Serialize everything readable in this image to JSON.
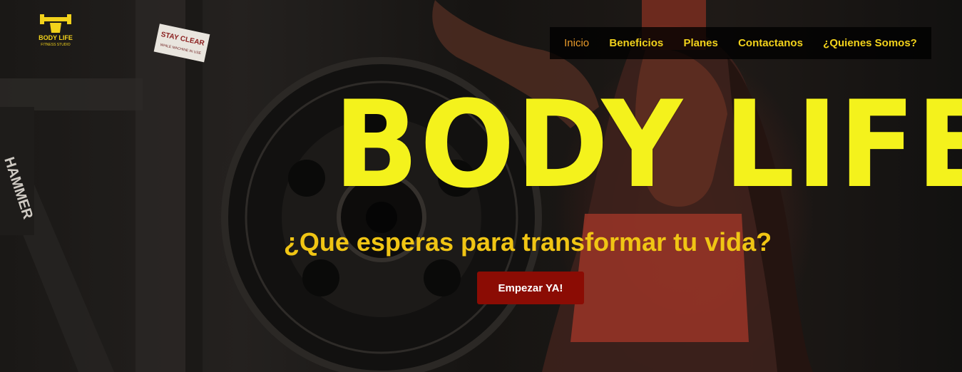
{
  "logo": {
    "icon": "dumbbell-fist-icon",
    "name": "BODY LIFE",
    "subtitle": "FITNESS STUDIO"
  },
  "nav": {
    "items": [
      {
        "label": "Inicio",
        "active": true
      },
      {
        "label": "Beneficios",
        "active": false
      },
      {
        "label": "Planes",
        "active": false
      },
      {
        "label": "Contactanos",
        "active": false
      },
      {
        "label": "¿Quienes Somos?",
        "active": false
      }
    ]
  },
  "hero": {
    "brand": "BODY LIFE",
    "tagline": "¿Que esperas para transformar tu vida?",
    "cta_label": "Empezar YA!",
    "equipment_sign": "STAY CLEAR",
    "equipment_sign_sub": "WHILE MACHINE IN USE",
    "machine_label": "HAMMER"
  },
  "colors": {
    "accent_yellow": "#f2d21b",
    "active_orange": "#e89a2a",
    "cta_red": "#8b0c04",
    "brand_yellow": "#f4f21c"
  }
}
